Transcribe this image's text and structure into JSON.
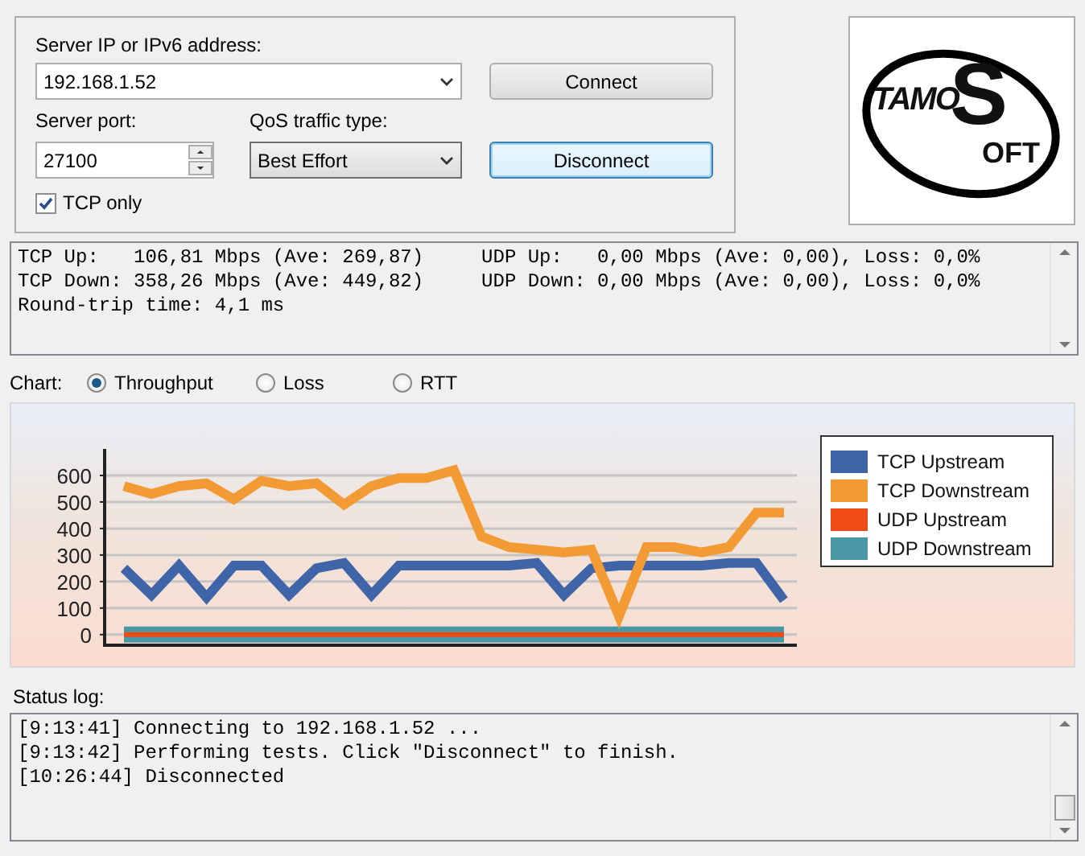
{
  "connection": {
    "server_label": "Server IP or IPv6  address:",
    "server_value": "192.168.1.52",
    "connect_button": "Connect",
    "port_label": "Server port:",
    "port_value": "27100",
    "qos_label": "QoS traffic type:",
    "qos_value": "Best Effort",
    "disconnect_button": "Disconnect",
    "tcp_only": {
      "label": "TCP only",
      "checked": true
    }
  },
  "logo": {
    "parts": [
      "TAMO",
      "S",
      "OFT"
    ]
  },
  "stats": {
    "lines": [
      "TCP Up:   106,81 Mbps (Ave: 269,87)     UDP Up:   0,00 Mbps (Ave: 0,00), Loss: 0,0%",
      "TCP Down: 358,26 Mbps (Ave: 449,82)     UDP Down: 0,00 Mbps (Ave: 0,00), Loss: 0,0%",
      "Round-trip time: 4,1 ms"
    ]
  },
  "chart_selector": {
    "label": "Chart:",
    "options": [
      {
        "label": "Throughput",
        "selected": true
      },
      {
        "label": "Loss",
        "selected": false
      },
      {
        "label": "RTT",
        "selected": false
      }
    ]
  },
  "chart": {
    "chart_data": {
      "type": "line",
      "legend": "right",
      "grid": true,
      "ylim": [
        -40,
        700
      ],
      "yticks": [
        0,
        100,
        200,
        300,
        400,
        500,
        600
      ],
      "series": [
        {
          "name": "TCP Upstream",
          "color": "#3f65a8",
          "values": [
            250,
            150,
            260,
            140,
            260,
            260,
            150,
            250,
            270,
            150,
            260,
            260,
            260,
            260,
            260,
            270,
            150,
            250,
            260,
            260,
            260,
            260,
            270,
            270,
            130
          ]
        },
        {
          "name": "TCP Downstream",
          "color": "#f29b35",
          "values": [
            560,
            530,
            560,
            570,
            510,
            580,
            560,
            570,
            490,
            560,
            590,
            590,
            620,
            370,
            330,
            320,
            310,
            320,
            70,
            330,
            330,
            310,
            330,
            460,
            460
          ]
        },
        {
          "name": "UDP Upstream",
          "color": "#ee4b17",
          "values": [
            0,
            0,
            0,
            0,
            0,
            0,
            0,
            0,
            0,
            0,
            0,
            0,
            0,
            0,
            0,
            0,
            0,
            0,
            0,
            0,
            0,
            0,
            0,
            0,
            0
          ]
        },
        {
          "name": "UDP Downstream",
          "color": "#4a98a6",
          "values": [
            0,
            0,
            0,
            0,
            0,
            0,
            0,
            0,
            0,
            0,
            0,
            0,
            0,
            0,
            0,
            0,
            0,
            0,
            0,
            0,
            0,
            0,
            0,
            0,
            0
          ]
        }
      ]
    }
  },
  "status_log": {
    "label": "Status log:",
    "lines": [
      "[9:13:41] Connecting to 192.168.1.52 ...",
      "[9:13:42] Performing tests. Click \"Disconnect\" to finish.",
      "[10:26:44] Disconnected"
    ]
  }
}
